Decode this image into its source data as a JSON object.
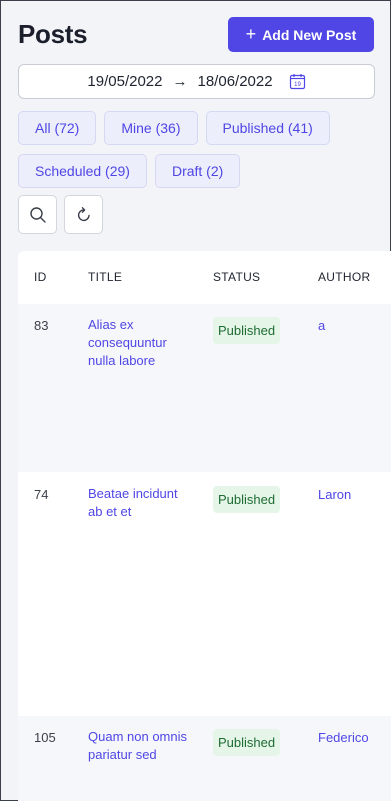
{
  "header": {
    "title": "Posts",
    "add_button_label": "Add New Post"
  },
  "date_range": {
    "start": "19/05/2022",
    "arrow": "→",
    "end": "18/06/2022",
    "calendar_day": "19"
  },
  "filters": [
    {
      "label": "All (72)"
    },
    {
      "label": "Mine (36)"
    },
    {
      "label": "Published (41)"
    },
    {
      "label": "Scheduled (29)"
    },
    {
      "label": "Draft (2)"
    }
  ],
  "icons": {
    "search": "search-icon",
    "refresh": "refresh-icon",
    "calendar": "calendar-icon",
    "plus": "plus-icon"
  },
  "table": {
    "columns": [
      "ID",
      "TITLE",
      "STATUS",
      "AUTHOR"
    ],
    "rows": [
      {
        "id": "83",
        "title": "Alias ex consequuntur nulla labore",
        "status": "Published",
        "author": "a"
      },
      {
        "id": "74",
        "title": "Beatae incidunt ab et et",
        "status": "Published",
        "author": "Laron"
      },
      {
        "id": "105",
        "title": "Quam non omnis pariatur sed",
        "status": "Published",
        "author": "Federico"
      }
    ]
  },
  "colors": {
    "accent": "#4f46e5",
    "badge_bg": "#e5f6e8",
    "badge_text": "#1e6b33"
  }
}
